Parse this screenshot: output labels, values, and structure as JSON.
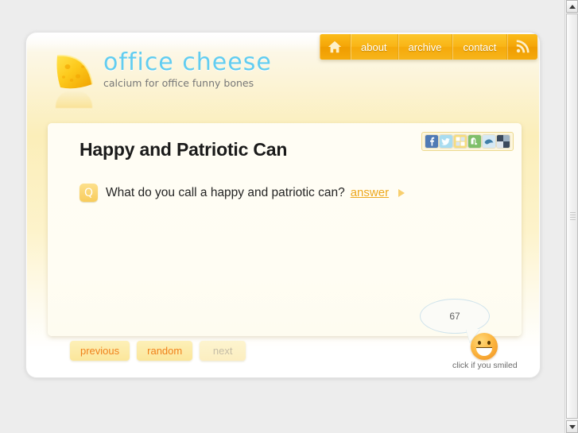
{
  "site": {
    "logo_word": "office cheese",
    "logo_tagline": "calcium for office funny bones",
    "logo_icon": "cheese-wedge-icon"
  },
  "nav": {
    "items": [
      {
        "label": "",
        "icon": "home-icon",
        "type": "icon",
        "active": true
      },
      {
        "label": "about",
        "icon": "",
        "type": "text",
        "active": false
      },
      {
        "label": "archive",
        "icon": "",
        "type": "text",
        "active": false
      },
      {
        "label": "contact",
        "icon": "",
        "type": "text",
        "active": false
      },
      {
        "label": "",
        "icon": "rss-icon",
        "type": "icon",
        "active": false
      }
    ]
  },
  "post": {
    "title": "Happy and Patriotic Can",
    "question_badge": "Q",
    "question": "What do you call a happy and patriotic can?",
    "answer_link": "answer",
    "answer_arrow": "play-triangle-icon"
  },
  "share": {
    "icons": [
      "facebook-icon",
      "twitter-icon",
      "delicious-icon",
      "stumbleupon-icon",
      "technorati-icon",
      "share-more-icon"
    ]
  },
  "pager": {
    "previous": "previous",
    "random": "random",
    "next": "next"
  },
  "smiley": {
    "count": "67",
    "caption": "click if you smiled",
    "face_icon": "smiley-face-icon"
  },
  "scrollbar": {
    "up_arrow": "scroll-up-icon",
    "down_arrow": "scroll-down-icon"
  },
  "colors": {
    "brand_blue": "#62cdf0",
    "brand_yellow": "#f9b517",
    "link_orange": "#eda81f",
    "button_text_orange": "#f0811a",
    "page_bg": "#ededed"
  }
}
